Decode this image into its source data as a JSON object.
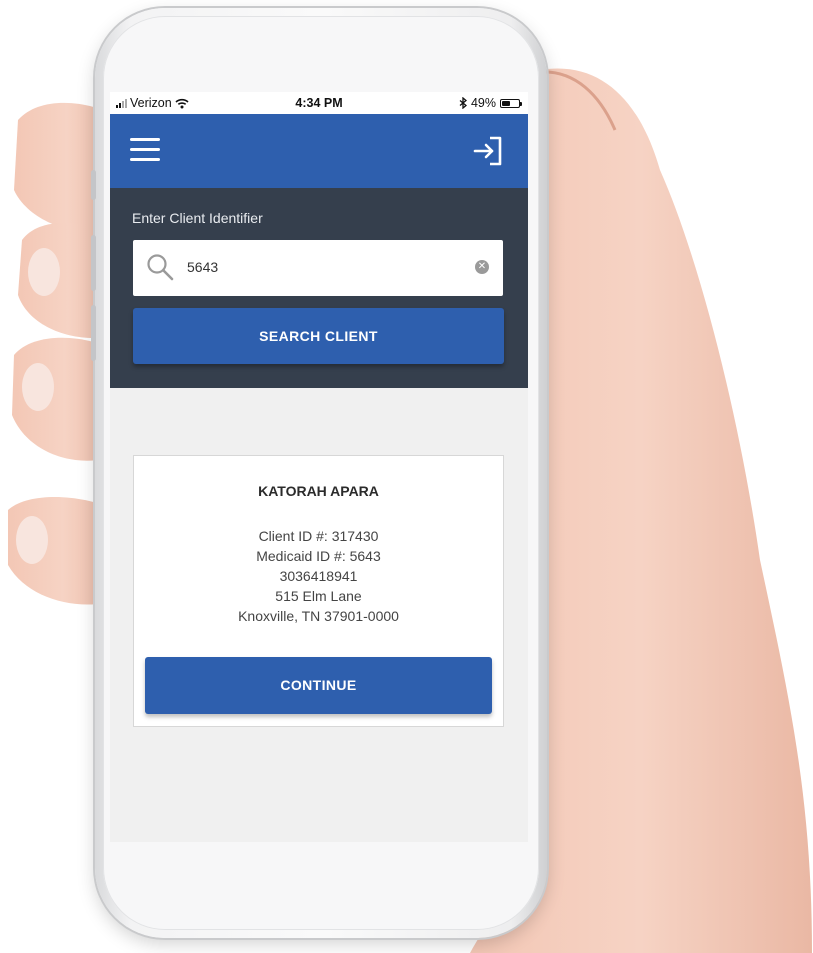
{
  "status_bar": {
    "carrier": "Verizon",
    "time": "4:34 PM",
    "battery_percent": "49%",
    "battery_level": 0.49
  },
  "header": {
    "menu_icon": "hamburger-menu-icon",
    "logout_icon": "logout-arrow-icon",
    "brand_color": "#2e5fae"
  },
  "search": {
    "label": "Enter Client Identifier",
    "value": "5643",
    "button_label": "SEARCH CLIENT",
    "panel_color": "#353f4d"
  },
  "client": {
    "name": "KATORAH APARA",
    "client_id": "Client ID #: 317430",
    "medicaid_id": "Medicaid ID #: 5643",
    "phone": "3036418941",
    "address_line1": "515 Elm Lane",
    "address_line2": "Knoxville, TN 37901-0000",
    "continue_label": "CONTINUE"
  }
}
